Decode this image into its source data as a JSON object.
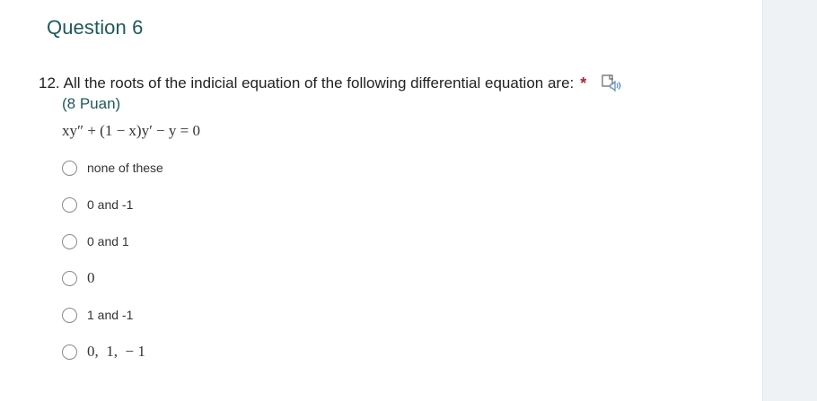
{
  "section": {
    "title": "Question 6"
  },
  "question": {
    "number": "12.",
    "text": "All the roots of the indicial equation of the following differential equation are:",
    "required_marker": "*",
    "points": "(8 Puan)",
    "equation": "xy″ + (1 − x)y′ − y = 0",
    "speaker_icon": "immersive-reader-icon"
  },
  "options": [
    {
      "label": "none of these",
      "selected": false
    },
    {
      "label": "0 and -1",
      "selected": false
    },
    {
      "label": "0 and 1",
      "selected": false
    },
    {
      "label": "0",
      "selected": false
    },
    {
      "label": "1 and -1",
      "selected": false
    },
    {
      "label": "0,  1,  − 1",
      "selected": false
    }
  ],
  "colors": {
    "title": "#1f5a5b",
    "required": "#a52a3a",
    "sidebar": "#eef2f4"
  }
}
